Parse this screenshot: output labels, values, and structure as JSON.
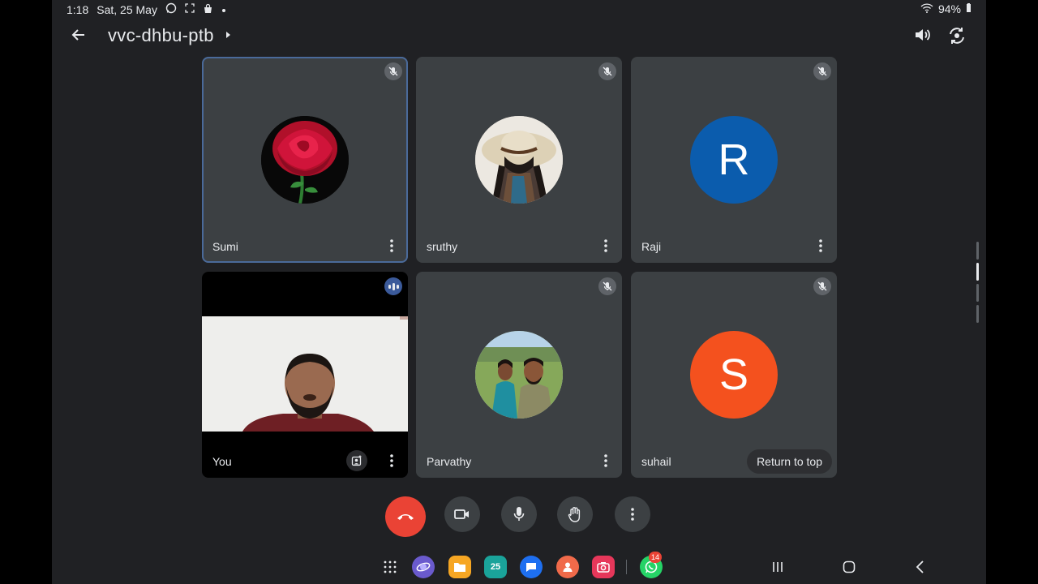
{
  "status_bar": {
    "time": "1:18",
    "date": "Sat, 25 May",
    "battery": "94%"
  },
  "header": {
    "meeting_code": "vvc-dhbu-ptb"
  },
  "participants": [
    {
      "name": "Sumi",
      "muted": true,
      "avatar": "rose-photo"
    },
    {
      "name": "sruthy",
      "muted": true,
      "avatar": "hat-photo"
    },
    {
      "name": "Raji",
      "muted": true,
      "avatar_letter": "R",
      "avatar_color": "#0b5cad"
    },
    {
      "name": "You",
      "speaking": true,
      "avatar": "camera-video"
    },
    {
      "name": "Parvathy",
      "muted": true,
      "avatar": "couple-photo"
    },
    {
      "name": "suhail",
      "muted": true,
      "avatar_letter": "S",
      "avatar_color": "#f4511e"
    }
  ],
  "return_to_top_label": "Return to top",
  "controls": [
    "end-call",
    "camera",
    "microphone",
    "raise-hand",
    "more-options"
  ],
  "navbar": {
    "apps": [
      "app-drawer",
      "samsung-internet",
      "my-files",
      "calendar",
      "messages",
      "contacts",
      "camera",
      "whatsapp"
    ],
    "calendar_day": "25",
    "whatsapp_badge": "14"
  },
  "colors": {
    "background": "#202124",
    "tile": "#3c4043",
    "end_call": "#ea4335",
    "active_border": "#4a6a9a"
  }
}
